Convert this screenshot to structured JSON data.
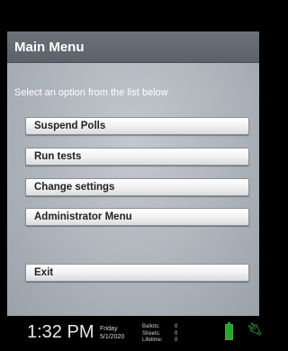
{
  "header": {
    "title": "Main Menu"
  },
  "instruction": "Select an option from the list below",
  "menu": {
    "suspend": "Suspend Polls",
    "run_tests": "Run tests",
    "change_settings": "Change settings",
    "admin": "Administrator Menu",
    "exit": "Exit"
  },
  "status": {
    "time": "1:32 PM",
    "day": "Friday",
    "date": "5/1/2020",
    "ballots_label": "Ballots:",
    "ballots": "0",
    "sheets_label": "Sheets:",
    "sheets": "0",
    "lifetime_label": "Lifetime:",
    "lifetime": "0",
    "battery_color": "#2aa42a",
    "plug_icon": "power-plug-icon"
  }
}
